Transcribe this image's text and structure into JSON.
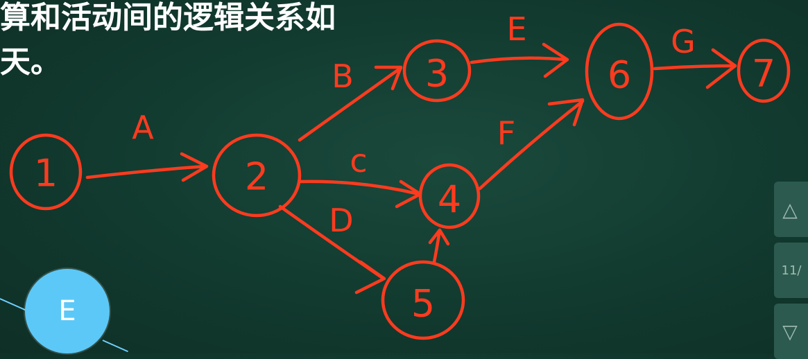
{
  "header": {
    "line1": "算和活动间的逻辑关系如",
    "line2": "天。"
  },
  "nodes": {
    "n1": "1",
    "n2": "2",
    "n3": "3",
    "n4": "4",
    "n5": "5",
    "n6": "6",
    "n7": "7"
  },
  "activities": {
    "a": "A",
    "b": "B",
    "c": "c",
    "d": "D",
    "e": "E",
    "f": "F",
    "g": "G"
  },
  "overlay": {
    "e_circle": "E"
  },
  "side_panel": {
    "up_icon": "chevron-up-icon",
    "page_indicator": "11/",
    "down_icon": "chevron-down-icon"
  }
}
